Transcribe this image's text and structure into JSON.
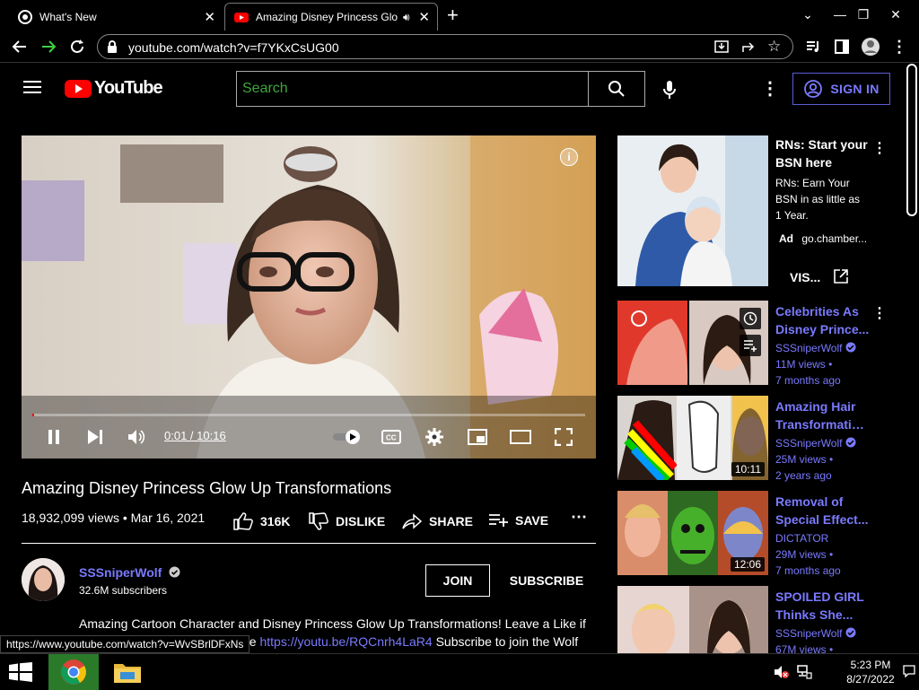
{
  "browser": {
    "tabs": [
      {
        "label": "What's New"
      },
      {
        "label": "Amazing Disney Princess Glo"
      }
    ],
    "url": "youtube.com/watch?v=f7YKxCsUG00",
    "status_url": "https://www.youtube.com/watch?v=WvSBrlDFxNs"
  },
  "youtube": {
    "logo_text": "YouTube",
    "search_placeholder": "Search",
    "sign_in": "SIGN IN"
  },
  "player": {
    "time": "0:01 / 10:16",
    "progress": 0.002
  },
  "video": {
    "title": "Amazing Disney Princess Glow Up Transformations",
    "views_date": "18,932,099 views • Mar 16, 2021",
    "likes": "316K",
    "dislike": "DISLIKE",
    "share": "SHARE",
    "save": "SAVE"
  },
  "channel": {
    "name": "SSSniperWolf",
    "subscribers": "32.6M subscribers",
    "join": "JOIN",
    "subscribe": "SUBSCRIBE",
    "description_1": "Amazing Cartoon Character and Disney Princess Glow Up Transformations! Leave a Like if",
    "description_2_pre": "ne",
    "description_link": "https://youtu.be/RQCnrh4LaR4",
    "description_2_post": "Subscribe to join the Wolf"
  },
  "ad": {
    "title_1": "RNs: Start your",
    "title_2": "BSN here",
    "body_1": "RNs: Earn Your",
    "body_2": "BSN in as little as",
    "body_3": "1 Year.",
    "badge": "Ad",
    "domain": "go.chamber...",
    "cta": "VIS..."
  },
  "recommendations": [
    {
      "title_1": "Celebrities As",
      "title_2": "Disney Prince...",
      "channel": "SSSniperWolf",
      "views": "11M views •",
      "age": "7 months ago",
      "duration": ""
    },
    {
      "title_1": "Amazing Hair",
      "title_2": "Transformatio...",
      "channel": "SSSniperWolf",
      "views": "25M views •",
      "age": "2 years ago",
      "duration": "10:11"
    },
    {
      "title_1": "Removal of",
      "title_2": "Special Effect...",
      "channel": "DICTATOR",
      "views": "29M views •",
      "age": "7 months ago",
      "duration": "12:06"
    },
    {
      "title_1": "SPOILED GIRL",
      "title_2": "Thinks She...",
      "channel": "SSSniperWolf",
      "views": "67M views •",
      "age": "",
      "duration": ""
    }
  ],
  "taskbar": {
    "time": "5:23 PM",
    "date": "8/27/2022"
  },
  "colors": {
    "link": "#7a7aff",
    "youtube_red": "#ff0000",
    "search_text": "#3ea63e"
  }
}
